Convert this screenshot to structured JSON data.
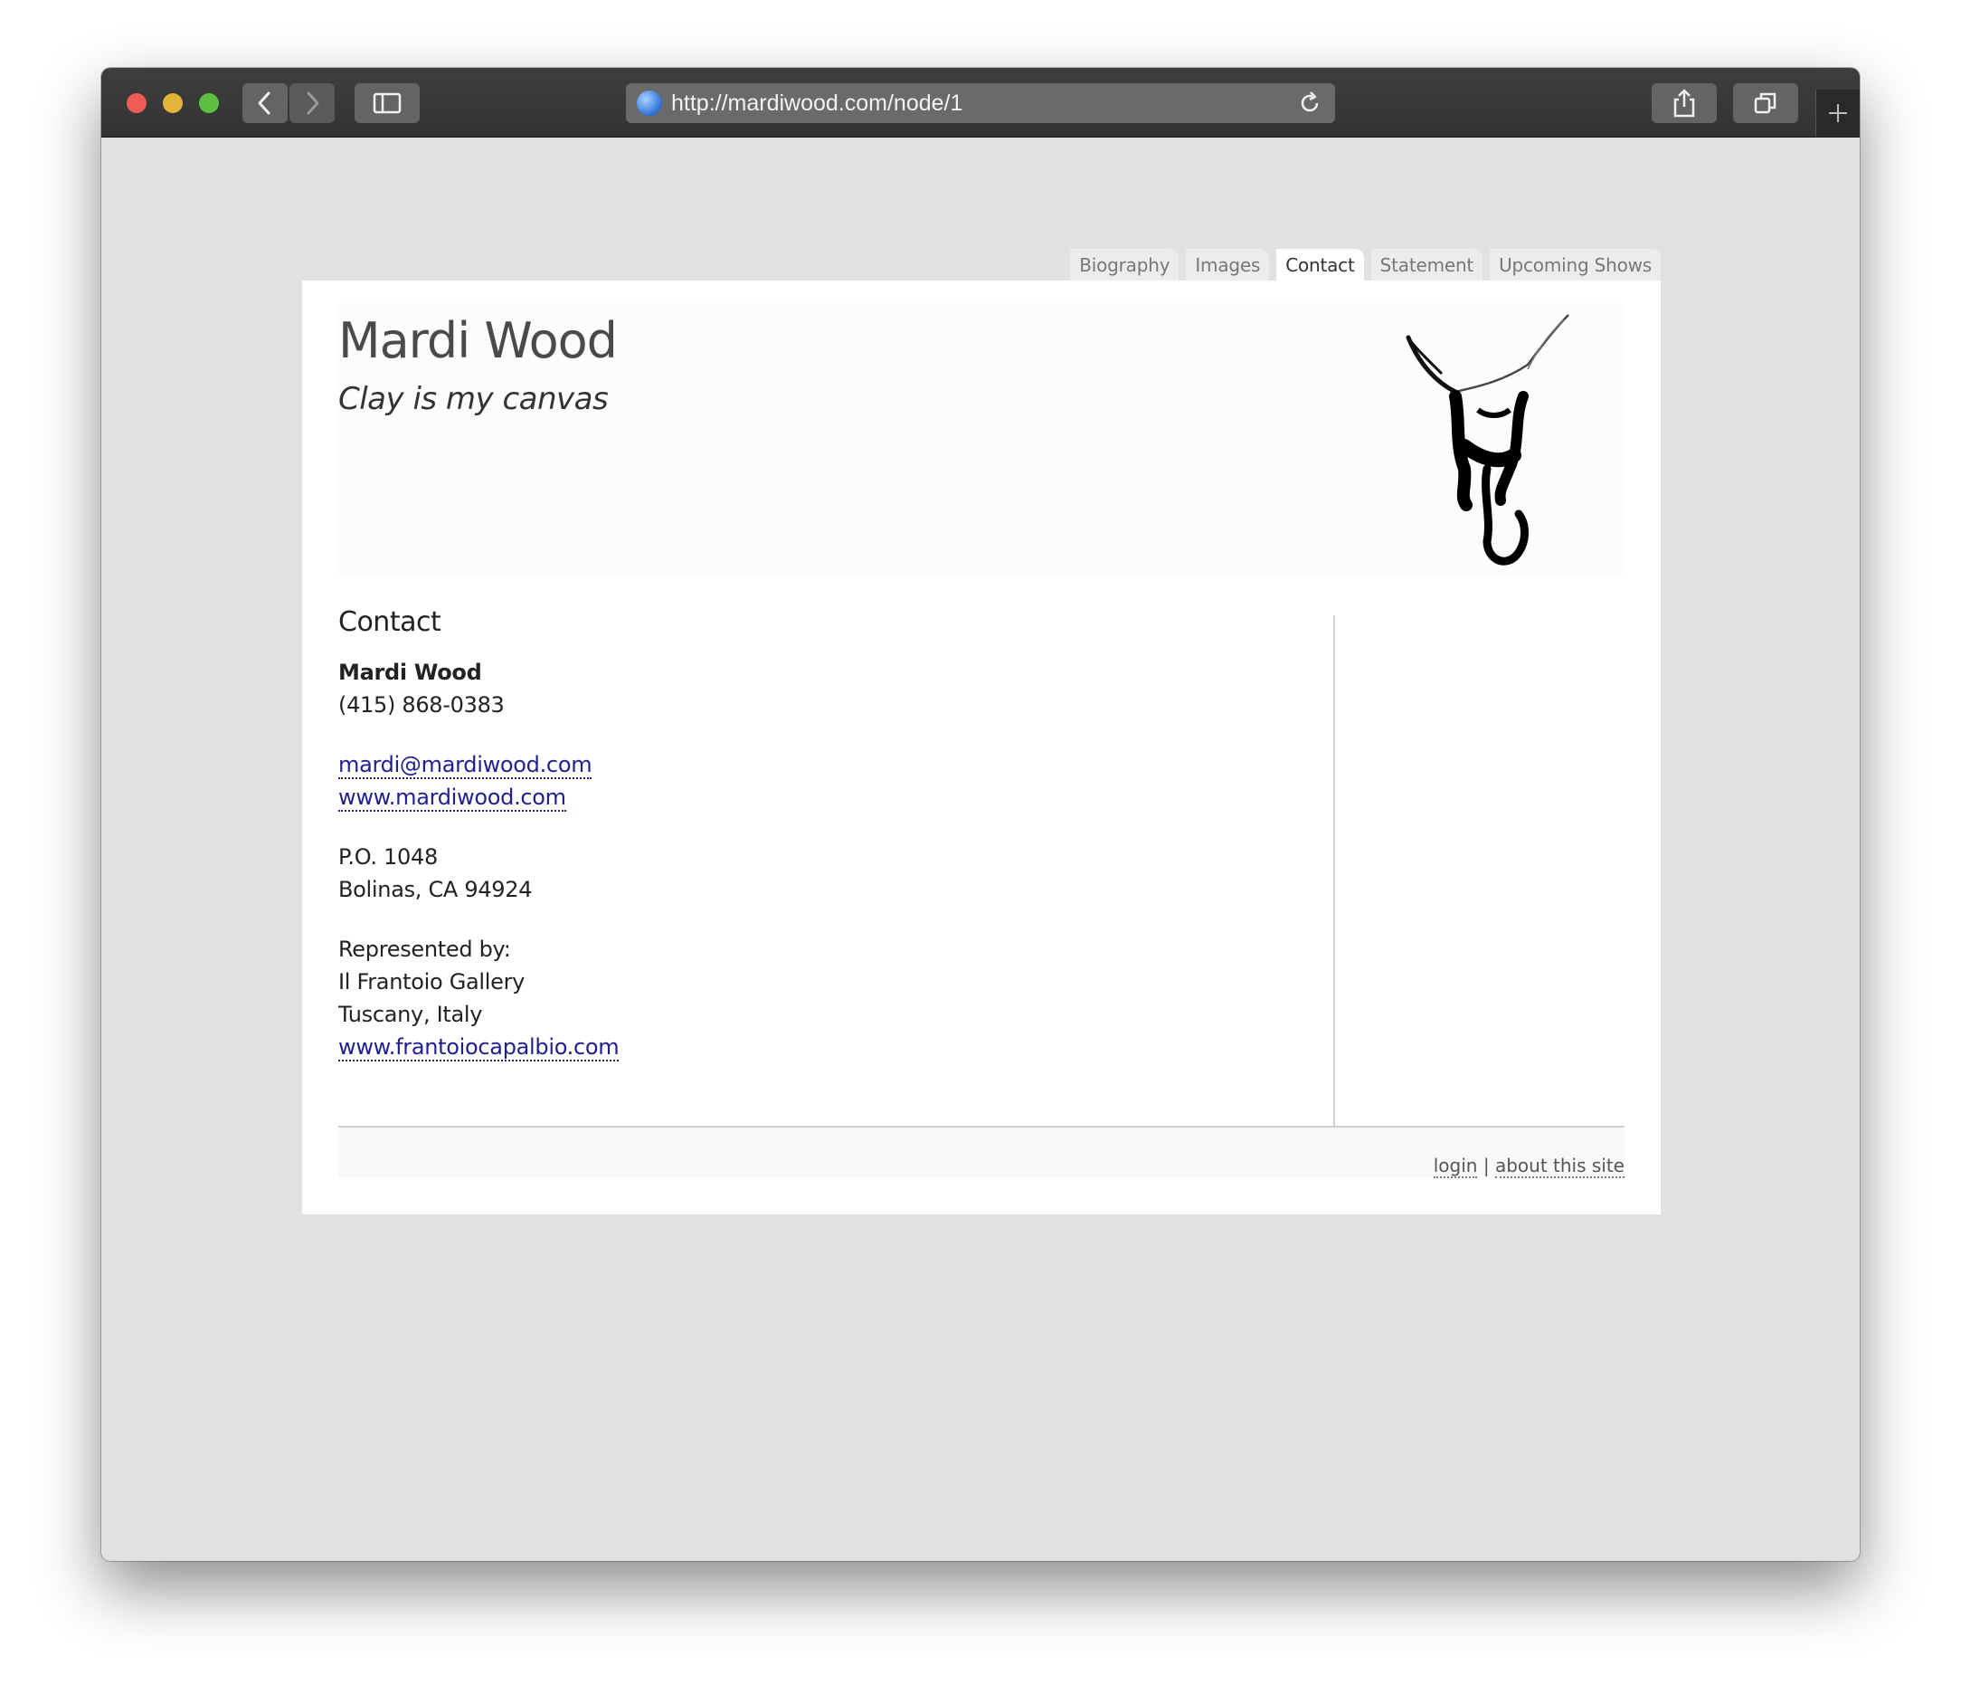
{
  "browser": {
    "url": "http://mardiwood.com/node/1"
  },
  "nav": {
    "tabs": [
      {
        "label": "Biography"
      },
      {
        "label": "Images"
      },
      {
        "label": "Contact"
      },
      {
        "label": "Statement"
      },
      {
        "label": "Upcoming Shows"
      }
    ],
    "active": "Contact"
  },
  "header": {
    "site_name": "Mardi Wood",
    "slogan": "Clay is my canvas"
  },
  "content": {
    "title": "Contact",
    "name": "Mardi Wood",
    "phone": "(415) 868-0383",
    "email": "mardi@mardiwood.com",
    "website": "www.mardiwood.com",
    "address_line1": "P.O. 1048",
    "address_line2": "Bolinas, CA 94924",
    "represented_label": "Represented by:",
    "gallery_name": "Il Frantoio Gallery",
    "gallery_location": "Tuscany, Italy",
    "gallery_url": "www.frantoiocapalbio.com"
  },
  "footer": {
    "login": "login",
    "separator": "|",
    "about": "about this site"
  }
}
